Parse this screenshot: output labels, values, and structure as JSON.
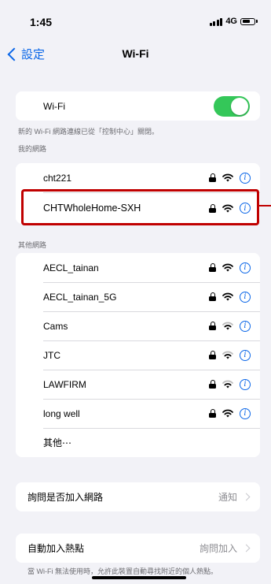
{
  "status_bar": {
    "time": "1:45",
    "network": "4G"
  },
  "nav": {
    "back_label": "設定",
    "title": "Wi-Fi"
  },
  "wifi_toggle": {
    "label": "Wi-Fi",
    "on": true,
    "caption": "新的 Wi-Fi 網路連線已從「控制中心」關閉。"
  },
  "my_networks": {
    "header": "我的網路",
    "items": [
      {
        "name": "cht221"
      },
      {
        "name": "CHTWholeHome-SXH"
      }
    ]
  },
  "other_networks": {
    "header": "其他網路",
    "items": [
      {
        "name": "AECL_tainan"
      },
      {
        "name": "AECL_tainan_5G"
      },
      {
        "name": "Cams"
      },
      {
        "name": "JTC"
      },
      {
        "name": "LAWFIRM"
      },
      {
        "name": "long well"
      }
    ],
    "other_label": "其他⋯"
  },
  "ask_to_join": {
    "label": "詢問是否加入網路",
    "value": "通知"
  },
  "auto_join_hotspot": {
    "label": "自動加入熱點",
    "value": "詢問加入",
    "caption": "當 Wi-Fi 無法使用時，允許此裝置自動尋找附近的個人熱點。"
  },
  "colors": {
    "accent": "#0a66e8",
    "toggle_on": "#34c759",
    "highlight": "#c00000"
  }
}
